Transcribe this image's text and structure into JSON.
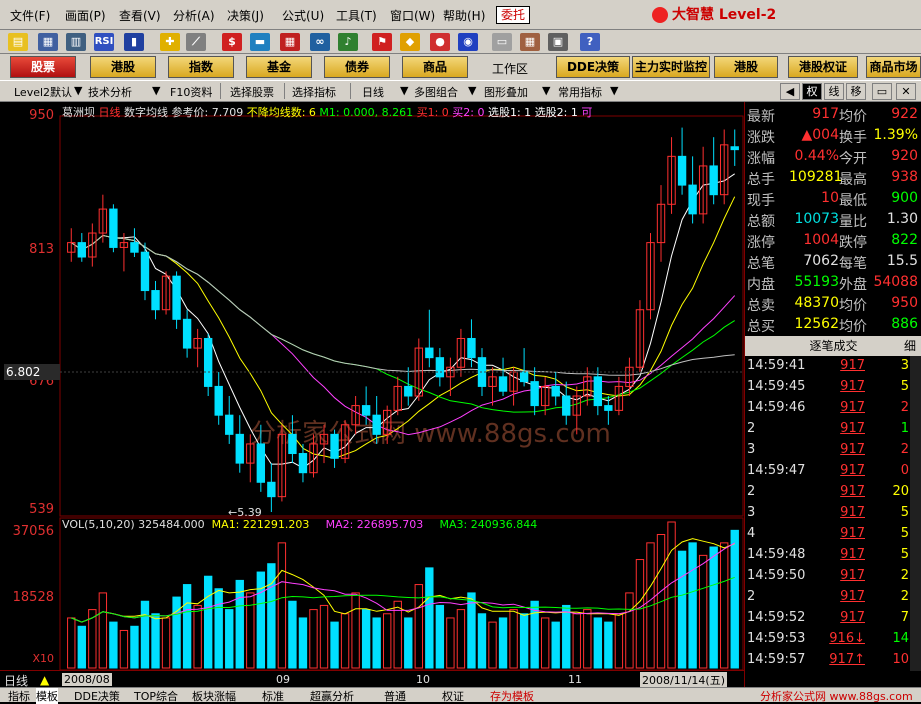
{
  "menu": [
    "文件(F)",
    "画面(P)",
    "查看(V)",
    "分析(A)",
    "决策(J)",
    "公式(U)",
    "工具(T)",
    "窗口(W)",
    "帮助(H)"
  ],
  "delegate_label": "委托",
  "app_logo": "大智慧 Level-2",
  "funcbar": {
    "items": [
      "股票",
      "港股",
      "指数",
      "基金",
      "债券",
      "商品"
    ],
    "workarea": "工作区",
    "right_items": [
      "DDE决策",
      "主力实时监控",
      "港股",
      "港股权证",
      "商品市场"
    ]
  },
  "subtabs": [
    "Level2默认",
    "技术分析",
    "F10资料",
    "选择股票",
    "选择指标",
    "日线",
    "多图组合",
    "图形叠加",
    "常用指标"
  ],
  "right_tabs": [
    "权",
    "线",
    "移"
  ],
  "chart_info": {
    "stock": "葛洲坝",
    "period": "日线",
    "indicator": "数字均线",
    "ref_label": "参考价: 7.709",
    "ma_label": "不降均线数: 6",
    "m1": "M1: 0.000, 8.261",
    "buy1": "买1: 0",
    "buy2": "买2: 0",
    "sel1": "选股1: 1",
    "sel2": "选股2: 1",
    "tail": "可"
  },
  "price_axis": [
    "950",
    "813",
    "676",
    "539"
  ],
  "cursor_value": "6.802",
  "low_mark": "5.39",
  "watermark": "分析家公式网 www.88gs.com",
  "vol_axis": [
    "37056",
    "18528",
    "X10"
  ],
  "vol_info": {
    "vol": "VOL(5,10,20) 325484.000",
    "ma1": "MA1: 221291.203",
    "ma2": "MA2: 226895.703",
    "ma3": "MA3: 240936.844"
  },
  "period_label": "日线",
  "date_axis": [
    "2008/08",
    "09",
    "10",
    "11"
  ],
  "date_current": "2008/11/14(五)",
  "quote": [
    {
      "l1": "最新",
      "v1": "917",
      "c1": "cr",
      "l2": "均价",
      "v2": "922",
      "c2": "cr"
    },
    {
      "l1": "涨跌",
      "v1": "▲004",
      "c1": "cr",
      "l2": "换手",
      "v2": "1.39%",
      "c2": "cy"
    },
    {
      "l1": "涨幅",
      "v1": "0.44%",
      "c1": "cr",
      "l2": "今开",
      "v2": "920",
      "c2": "cr"
    },
    {
      "l1": "总手",
      "v1": "109281",
      "c1": "cy",
      "l2": "最高",
      "v2": "938",
      "c2": "cr"
    },
    {
      "l1": "现手",
      "v1": "10",
      "c1": "cr",
      "l2": "最低",
      "v2": "900",
      "c2": "cg"
    },
    {
      "l1": "总额",
      "v1": "10073",
      "c1": "cc",
      "l2": "量比",
      "v2": "1.30",
      "c2": "cw"
    },
    {
      "l1": "涨停",
      "v1": "1004",
      "c1": "cr",
      "l2": "跌停",
      "v2": "822",
      "c2": "cg"
    },
    {
      "l1": "总笔",
      "v1": "7062",
      "c1": "cw",
      "l2": "每笔",
      "v2": "15.5",
      "c2": "cw"
    },
    {
      "l1": "内盘",
      "v1": "55193",
      "c1": "cg",
      "l2": "外盘",
      "v2": "54088",
      "c2": "cr"
    },
    {
      "l1": "总卖",
      "v1": "48370",
      "c1": "cy",
      "l2": "均价",
      "v2": "950",
      "c2": "cr"
    },
    {
      "l1": "总买",
      "v1": "12562",
      "c1": "cy",
      "l2": "均价",
      "v2": "886",
      "c2": "cg"
    }
  ],
  "ticks_header": "逐笔成交",
  "ticks_header_right": "细",
  "ticks": [
    {
      "t": "14:59:41",
      "p": "917",
      "q": "3",
      "qc": "cy"
    },
    {
      "t": "14:59:45",
      "p": "917",
      "q": "5",
      "qc": "cy"
    },
    {
      "t": "14:59:46",
      "p": "917",
      "q": "2",
      "qc": "cr"
    },
    {
      "t": "2",
      "p": "917",
      "q": "1",
      "qc": "cg"
    },
    {
      "t": "3",
      "p": "917",
      "q": "2",
      "qc": "cr"
    },
    {
      "t": "14:59:47",
      "p": "917",
      "q": "0",
      "qc": "cr"
    },
    {
      "t": "2",
      "p": "917",
      "q": "20",
      "qc": "cy"
    },
    {
      "t": "3",
      "p": "917",
      "q": "5",
      "qc": "cy"
    },
    {
      "t": "4",
      "p": "917",
      "q": "5",
      "qc": "cy"
    },
    {
      "t": "14:59:48",
      "p": "917",
      "q": "5",
      "qc": "cy"
    },
    {
      "t": "14:59:50",
      "p": "917",
      "q": "2",
      "qc": "cy"
    },
    {
      "t": "2",
      "p": "917",
      "q": "2",
      "qc": "cy"
    },
    {
      "t": "14:59:52",
      "p": "917",
      "q": "7",
      "qc": "cy"
    },
    {
      "t": "14:59:53",
      "p": "916↓",
      "q": "14",
      "qc": "cg"
    },
    {
      "t": "14:59:57",
      "p": "917↑",
      "q": "10",
      "qc": "cr"
    }
  ],
  "bottom_tabs": [
    "指标",
    "模板",
    "DDE决策",
    "TOP综合",
    "板块涨幅",
    "标准",
    "超赢分析",
    "普通",
    "权证",
    "存为模板"
  ],
  "footer_right": "分析家公式网 www.88gs.com",
  "chart_data": {
    "type": "candlestick",
    "title": "葛洲坝 日线",
    "ylim": [
      5.39,
      9.5
    ],
    "candles": [
      [
        8.1,
        8.35,
        8.0,
        8.2
      ],
      [
        8.2,
        8.3,
        8.0,
        8.05
      ],
      [
        8.05,
        8.4,
        7.95,
        8.3
      ],
      [
        8.3,
        8.7,
        8.2,
        8.55
      ],
      [
        8.55,
        8.6,
        8.1,
        8.15
      ],
      [
        8.15,
        8.3,
        7.9,
        8.2
      ],
      [
        8.2,
        8.35,
        8.05,
        8.1
      ],
      [
        8.1,
        8.2,
        7.6,
        7.7
      ],
      [
        7.7,
        7.8,
        7.4,
        7.5
      ],
      [
        7.5,
        7.9,
        7.45,
        7.85
      ],
      [
        7.85,
        7.9,
        7.3,
        7.4
      ],
      [
        7.4,
        7.5,
        7.0,
        7.1
      ],
      [
        7.1,
        7.3,
        6.9,
        7.2
      ],
      [
        7.2,
        7.25,
        6.6,
        6.7
      ],
      [
        6.7,
        6.85,
        6.3,
        6.4
      ],
      [
        6.4,
        6.6,
        6.1,
        6.2
      ],
      [
        6.2,
        6.4,
        5.8,
        5.9
      ],
      [
        5.9,
        6.2,
        5.7,
        6.1
      ],
      [
        6.1,
        6.3,
        5.6,
        5.7
      ],
      [
        5.7,
        5.9,
        5.39,
        5.55
      ],
      [
        5.55,
        6.3,
        5.5,
        6.2
      ],
      [
        6.2,
        6.4,
        5.9,
        6.0
      ],
      [
        6.0,
        6.1,
        5.7,
        5.8
      ],
      [
        5.8,
        6.2,
        5.75,
        6.1
      ],
      [
        6.1,
        6.3,
        5.9,
        6.2
      ],
      [
        6.2,
        6.25,
        5.85,
        5.95
      ],
      [
        5.95,
        6.35,
        5.9,
        6.3
      ],
      [
        6.3,
        6.6,
        6.2,
        6.5
      ],
      [
        6.5,
        6.7,
        6.3,
        6.4
      ],
      [
        6.4,
        6.6,
        6.1,
        6.2
      ],
      [
        6.2,
        6.5,
        6.1,
        6.45
      ],
      [
        6.45,
        6.8,
        6.4,
        6.7
      ],
      [
        6.7,
        6.9,
        6.5,
        6.6
      ],
      [
        6.6,
        7.2,
        6.55,
        7.1
      ],
      [
        7.1,
        7.5,
        6.9,
        7.0
      ],
      [
        7.0,
        7.1,
        6.7,
        6.8
      ],
      [
        6.8,
        7.0,
        6.6,
        6.9
      ],
      [
        6.9,
        7.3,
        6.8,
        7.2
      ],
      [
        7.2,
        7.4,
        6.9,
        7.0
      ],
      [
        7.0,
        7.1,
        6.6,
        6.7
      ],
      [
        6.7,
        6.9,
        6.5,
        6.8
      ],
      [
        6.8,
        7.0,
        6.6,
        6.65
      ],
      [
        6.65,
        6.9,
        6.5,
        6.85
      ],
      [
        6.85,
        7.1,
        6.7,
        6.75
      ],
      [
        6.75,
        6.9,
        6.4,
        6.5
      ],
      [
        6.5,
        6.8,
        6.4,
        6.7
      ],
      [
        6.7,
        6.85,
        6.5,
        6.6
      ],
      [
        6.6,
        6.75,
        6.3,
        6.4
      ],
      [
        6.4,
        6.7,
        6.2,
        6.6
      ],
      [
        6.6,
        6.9,
        6.5,
        6.8
      ],
      [
        6.8,
        6.9,
        6.4,
        6.5
      ],
      [
        6.5,
        6.6,
        6.3,
        6.45
      ],
      [
        6.45,
        6.8,
        6.4,
        6.7
      ],
      [
        6.7,
        7.0,
        6.6,
        6.9
      ],
      [
        6.9,
        7.6,
        6.85,
        7.5
      ],
      [
        7.5,
        8.3,
        7.4,
        8.2
      ],
      [
        8.2,
        8.8,
        8.0,
        8.6
      ],
      [
        8.6,
        9.3,
        8.5,
        9.1
      ],
      [
        9.1,
        9.4,
        8.7,
        8.8
      ],
      [
        8.8,
        9.1,
        8.4,
        8.5
      ],
      [
        8.5,
        9.2,
        8.4,
        9.0
      ],
      [
        9.0,
        9.3,
        8.6,
        8.7
      ],
      [
        8.7,
        9.38,
        8.6,
        9.22
      ],
      [
        9.2,
        9.38,
        9.0,
        9.17
      ]
    ],
    "volume": [
      12,
      10,
      14,
      18,
      11,
      9,
      10,
      16,
      13,
      12,
      17,
      20,
      15,
      22,
      19,
      14,
      21,
      18,
      23,
      25,
      30,
      16,
      12,
      14,
      15,
      11,
      13,
      18,
      14,
      12,
      13,
      16,
      12,
      20,
      24,
      15,
      12,
      14,
      18,
      13,
      11,
      12,
      14,
      13,
      16,
      12,
      11,
      15,
      13,
      14,
      12,
      11,
      13,
      18,
      26,
      30,
      32,
      35,
      28,
      30,
      27,
      29,
      30,
      33
    ],
    "series": [
      {
        "name": "MA1",
        "values_desc": "short moving average"
      },
      {
        "name": "MA2",
        "values_desc": "mid moving average"
      },
      {
        "name": "MA3",
        "values_desc": "long moving average"
      }
    ]
  },
  "colors": {
    "up": "#ff3030",
    "down": "#00e0ff",
    "ma_white": "#ffffff",
    "ma_yellow": "#ffff00",
    "ma_magenta": "#ff40ff",
    "ma_green": "#00ff00",
    "grid": "#800000"
  }
}
